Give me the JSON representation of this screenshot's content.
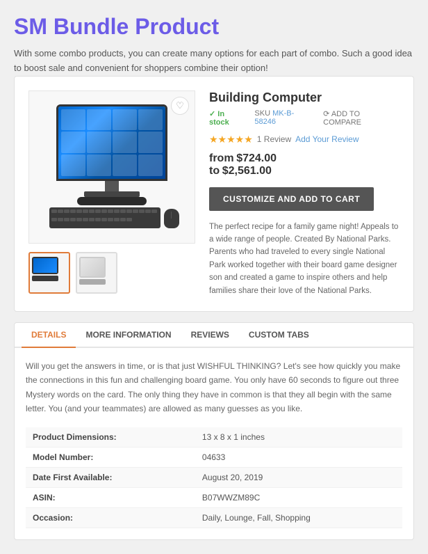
{
  "header": {
    "title": "SM Bundle Product",
    "description": "With some combo products, you can create many options for each part of combo. Such a good idea to boost sale and convenient for shoppers combine their option!"
  },
  "product": {
    "name": "Building Computer",
    "in_stock": "In stock",
    "sku_label": "SKU",
    "sku_value": "MK-B-58246",
    "compare_label": "ADD TO COMPARE",
    "stars_count": "★★★★★",
    "reviews_count": "1 Review",
    "add_review_label": "Add Your Review",
    "price_from_label": "from",
    "price_from": "$724.00",
    "price_to_label": "to",
    "price_to": "$2,561.00",
    "customize_btn": "CUSTOMIZE AND ADD TO CART",
    "description": "The perfect recipe for a family game night! Appeals to a wide range of people. Created By National Parks. Parents who had traveled to every single National Park worked together with their board game designer son and created a game to inspire others and help families share their love of the National Parks."
  },
  "tabs": {
    "items": [
      {
        "label": "DETAILS",
        "active": true
      },
      {
        "label": "MORE INFORMATION",
        "active": false
      },
      {
        "label": "REVIEWS",
        "active": false
      },
      {
        "label": "CUSTOM TABS",
        "active": false
      }
    ],
    "details_text": "Will you get the answers in time, or is that just WISHFUL THINKING? Let's see how quickly you make the connections in this fun and challenging board game. You only have 60 seconds to figure out three Mystery words on the card. The only thing they have in common is that they all begin with the same letter. You (and your teammates) are allowed as many guesses as you like.",
    "specs": [
      {
        "label": "Product Dimensions:",
        "value": "13 x 8 x 1 inches"
      },
      {
        "label": "Model Number:",
        "value": "04633"
      },
      {
        "label": "Date First Available:",
        "value": "August 20, 2019"
      },
      {
        "label": "ASIN:",
        "value": "B07WWZM89C"
      },
      {
        "label": "Occasion:",
        "value": "Daily, Lounge, Fall, Shopping"
      }
    ]
  },
  "icons": {
    "heart": "♡",
    "compare": "⟳",
    "checkmark": "✓"
  }
}
